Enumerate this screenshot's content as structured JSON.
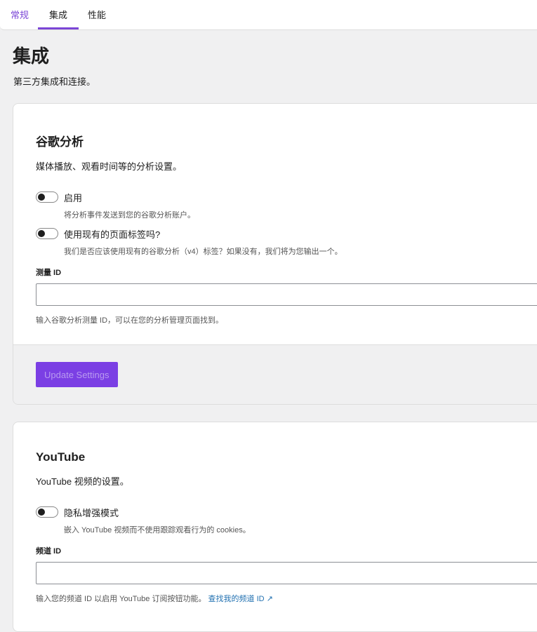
{
  "tabs": [
    "常规",
    "集成",
    "性能"
  ],
  "page": {
    "title": "集成",
    "subtitle": "第三方集成和连接。"
  },
  "ga": {
    "title": "谷歌分析",
    "desc": "媒体播放、观看时间等的分析设置。",
    "enable_label": "启用",
    "enable_help": "将分析事件发送到您的谷歌分析账户。",
    "existing_label": "使用现有的页面标签吗?",
    "existing_help": "我们是否应该使用现有的谷歌分析（v4）标签？如果没有，我们将为您输出一个。",
    "measure_label": "测量 ID",
    "measure_value": "",
    "measure_help": "输入谷歌分析测量 ID，可以在您的分析管理页面找到。",
    "button": "Update Settings"
  },
  "yt": {
    "title": "YouTube",
    "desc": "YouTube 视频的设置。",
    "privacy_label": "隐私增强模式",
    "privacy_help": "嵌入 YouTube 视频而不使用跟踪观看行为的 cookies。",
    "channel_label": "频道 ID",
    "channel_value": "",
    "channel_help": "输入您的频道 ID 以启用 YouTube 订阅按钮功能。",
    "channel_link": "查找我的频道 ID ↗"
  }
}
